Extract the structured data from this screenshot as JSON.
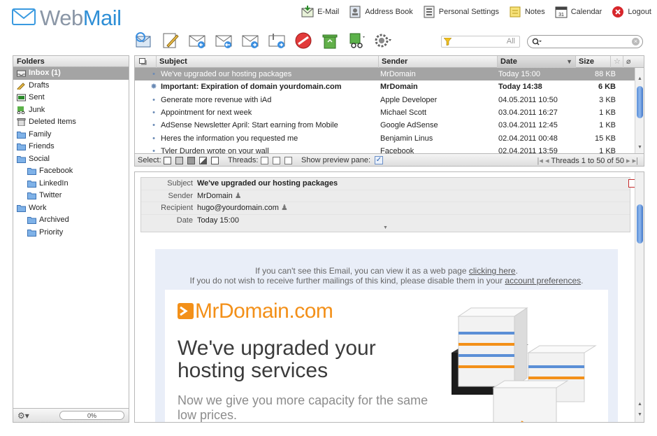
{
  "app": {
    "logo_text_web": "Web",
    "logo_text_mail": "Mail"
  },
  "topnav": [
    {
      "label": "E-Mail",
      "icon": "email-icon"
    },
    {
      "label": "Address Book",
      "icon": "address-book-icon"
    },
    {
      "label": "Personal Settings",
      "icon": "settings-icon"
    },
    {
      "label": "Notes",
      "icon": "notes-icon"
    },
    {
      "label": "Calendar",
      "icon": "calendar-icon"
    },
    {
      "label": "Logout",
      "icon": "logout-icon"
    }
  ],
  "calendar_icon_day": "31",
  "toolbar": {
    "buttons": [
      "check-mail",
      "compose",
      "reply",
      "reply-all",
      "forward",
      "forward-attachment",
      "delete",
      "recycle",
      "spam",
      "actions"
    ]
  },
  "filter": {
    "value": "All"
  },
  "search": {
    "placeholder": ""
  },
  "folders": {
    "header": "Folders",
    "items": [
      {
        "label": "Inbox (1)",
        "icon": "inbox-icon",
        "level": 0,
        "selected": true
      },
      {
        "label": "Drafts",
        "icon": "drafts-icon",
        "level": 0
      },
      {
        "label": "Sent",
        "icon": "sent-icon",
        "level": 0
      },
      {
        "label": "Junk",
        "icon": "junk-icon",
        "level": 0
      },
      {
        "label": "Deleted Items",
        "icon": "trash-icon",
        "level": 0
      },
      {
        "label": "Family",
        "icon": "folder-icon",
        "level": 0
      },
      {
        "label": "Friends",
        "icon": "folder-icon",
        "level": 0
      },
      {
        "label": "Social",
        "icon": "folder-icon",
        "level": 0
      },
      {
        "label": "Facebook",
        "icon": "folder-icon",
        "level": 1
      },
      {
        "label": "LinkedIn",
        "icon": "folder-icon",
        "level": 1
      },
      {
        "label": "Twitter",
        "icon": "folder-icon",
        "level": 1
      },
      {
        "label": "Work",
        "icon": "folder-icon",
        "level": 0
      },
      {
        "label": "Archived",
        "icon": "folder-icon",
        "level": 1
      },
      {
        "label": "Priority",
        "icon": "folder-icon",
        "level": 1
      }
    ],
    "quota": "0%"
  },
  "list": {
    "columns": {
      "subject": "Subject",
      "sender": "Sender",
      "date": "Date",
      "size": "Size"
    },
    "rows": [
      {
        "subject": "We've upgraded our hosting packages",
        "sender": "MrDomain",
        "date": "Today 15:00",
        "size": "88 KB",
        "selected": true,
        "unread": false,
        "icon": "•"
      },
      {
        "subject": "Important: Expiration of domain yourdomain.com",
        "sender": "MrDomain",
        "date": "Today 14:38",
        "size": "6 KB",
        "unread": true,
        "icon": "✸"
      },
      {
        "subject": "Generate more revenue with iAd",
        "sender": "Apple Developer",
        "date": "04.05.2011 10:50",
        "size": "3 KB",
        "icon": "•"
      },
      {
        "subject": "Appointment for next week",
        "sender": "Michael Scott",
        "date": "03.04.2011 16:27",
        "size": "1 KB",
        "icon": "•"
      },
      {
        "subject": "AdSense Newsletter April: Start earning from Mobile",
        "sender": "Google AdSense",
        "date": "03.04.2011 12:45",
        "size": "1 KB",
        "icon": "•"
      },
      {
        "subject": "Heres the information you requested me",
        "sender": "Benjamin Linus",
        "date": "02.04.2011 00:48",
        "size": "15 KB",
        "icon": "•"
      },
      {
        "subject": "Tyler Durden wrote on your wall",
        "sender": "Facebook",
        "date": "02.04.2011 13:59",
        "size": "1 KB",
        "icon": "•"
      }
    ],
    "footer": {
      "select_label": "Select:",
      "threads_label": "Threads:",
      "preview_label": "Show preview pane:",
      "pager": "Threads 1 to 50 of 50"
    }
  },
  "preview": {
    "subject_key": "Subject",
    "subject": "We've upgraded our hosting packages",
    "sender_key": "Sender",
    "sender": "MrDomain",
    "recipient_key": "Recipient",
    "recipient": "hugo@yourdomain.com",
    "date_key": "Date",
    "date": "Today 15:00",
    "note1_pre": "If you can't see this Email, you can view it as a web page ",
    "note1_link": "clicking here",
    "note1_post": ".",
    "note2_pre": "If you do not wish to receive further mailings of this kind, please disable them in your ",
    "note2_link": "account preferences",
    "note2_post": ".",
    "brand": "MrDomain.com",
    "headline": "We've upgraded your hosting services",
    "subline": "Now we give you more capacity for the same low prices."
  },
  "colors": {
    "accent": "#2f8fd6",
    "selected_row": "#a4a4a4",
    "brand_orange": "#f39019"
  }
}
